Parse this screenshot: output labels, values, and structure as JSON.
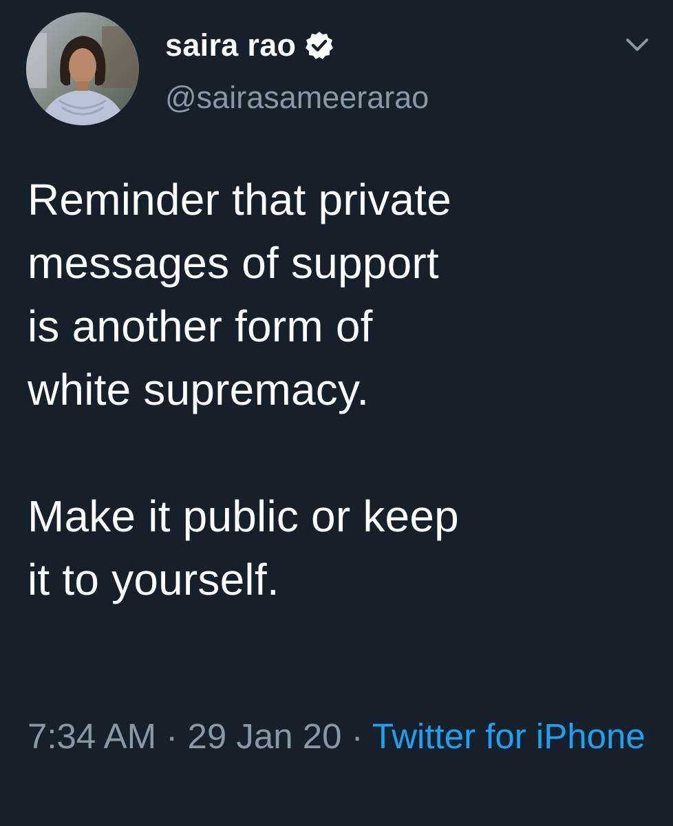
{
  "tweet": {
    "display_name": "saira rao",
    "handle": "@sairasameerarao",
    "text_lines": [
      "Reminder that private",
      "messages of support",
      "is another form of",
      "white supremacy.",
      "",
      "Make it public or keep",
      "it to yourself."
    ],
    "time": "7:34 AM",
    "separator": " · ",
    "date": "29 Jan 20",
    "source": "Twitter for iPhone"
  },
  "icons": {
    "verified": "verified-badge-icon",
    "caret": "chevron-down-icon"
  },
  "colors": {
    "background": "#15202b",
    "text": "#ffffff",
    "secondary": "#8899a6",
    "link": "#1da1f2"
  }
}
